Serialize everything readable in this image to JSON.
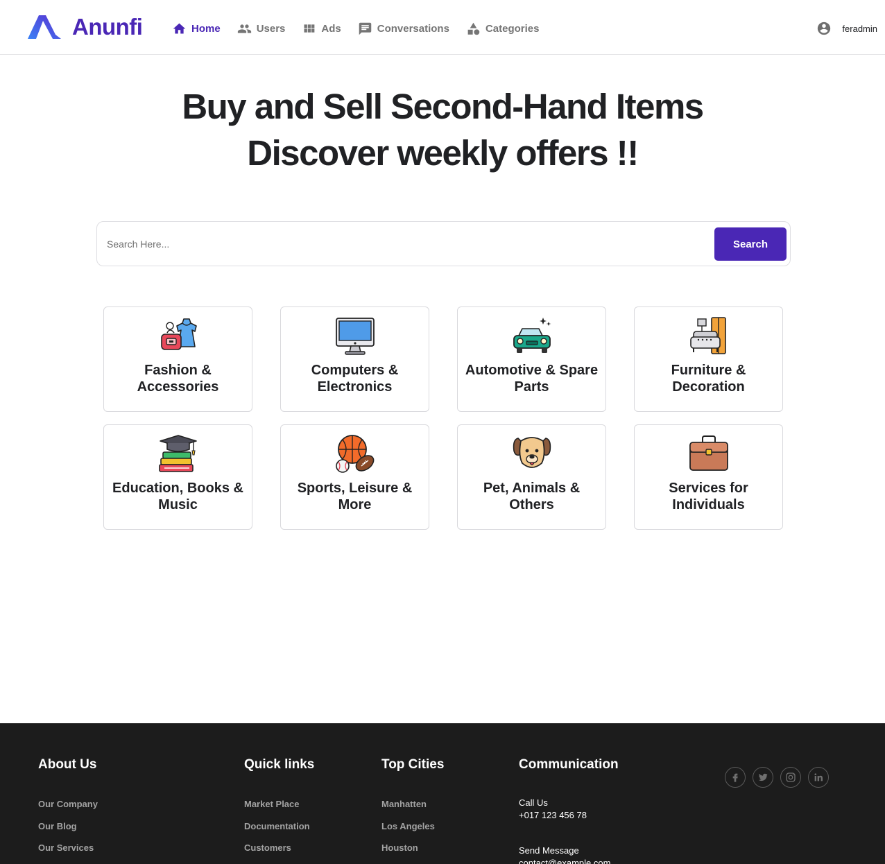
{
  "brand": {
    "name": "Anunfi",
    "accent": "#4a27b5"
  },
  "nav": {
    "items": [
      {
        "label": "Home",
        "icon": "home-icon",
        "active": true
      },
      {
        "label": "Users",
        "icon": "users-icon"
      },
      {
        "label": "Ads",
        "icon": "grid-icon"
      },
      {
        "label": "Conversations",
        "icon": "chat-icon"
      },
      {
        "label": "Categories",
        "icon": "shapes-icon"
      }
    ]
  },
  "user": {
    "name": "feradmin",
    "icon": "account-circle-icon"
  },
  "hero": {
    "line1": "Buy and Sell Second-Hand Items",
    "line2": "Discover weekly offers !!"
  },
  "search": {
    "placeholder": "Search Here...",
    "button_label": "Search"
  },
  "categories": [
    {
      "label": "Fashion & Accessories",
      "icon": "dress-bag-icon"
    },
    {
      "label": "Computers & Electronics",
      "icon": "monitor-icon"
    },
    {
      "label": "Automotive & Spare Parts",
      "icon": "car-icon"
    },
    {
      "label": "Furniture & Decoration",
      "icon": "sofa-icon"
    },
    {
      "label": "Education, Books & Music",
      "icon": "books-graduation-icon"
    },
    {
      "label": "Sports, Leisure & More",
      "icon": "balls-icon"
    },
    {
      "label": "Pet, Animals & Others",
      "icon": "dog-icon"
    },
    {
      "label": "Services for Individuals",
      "icon": "briefcase-icon"
    }
  ],
  "footer": {
    "about": {
      "title": "About Us",
      "links": [
        "Our Company",
        "Our Blog",
        "Our Services"
      ]
    },
    "quick": {
      "title": "Quick links",
      "links": [
        "Market Place",
        "Documentation",
        "Customers"
      ]
    },
    "cities": {
      "title": "Top Cities",
      "links": [
        "Manhatten",
        "Los Angeles",
        "Houston"
      ]
    },
    "communication": {
      "title": "Communication",
      "call_label": "Call Us",
      "call_value": "+017 123 456 78",
      "message_label": "Send Message",
      "message_value": "contact@example.com"
    },
    "socials": [
      "facebook-icon",
      "twitter-icon",
      "instagram-icon",
      "linkedin-icon"
    ]
  }
}
